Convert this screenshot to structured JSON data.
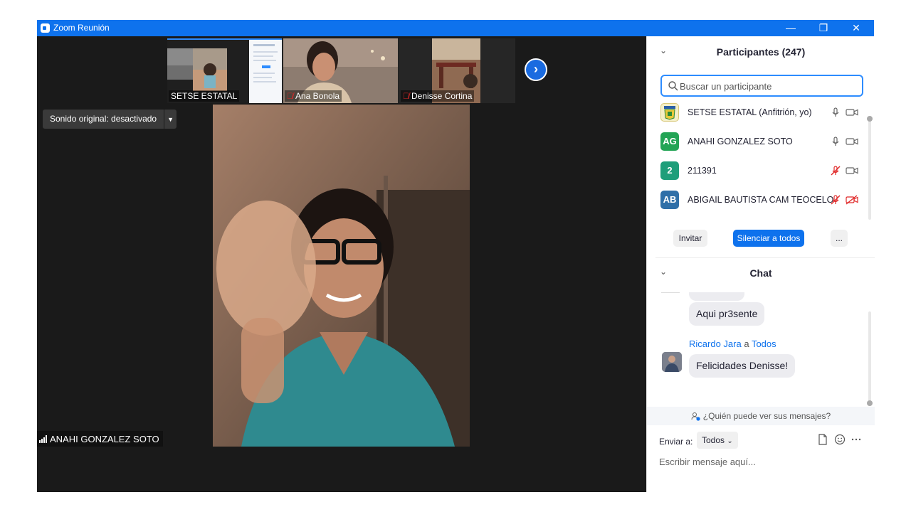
{
  "window": {
    "title": "Zoom Reunión",
    "controls": {
      "minimize": "—",
      "restore": "❐",
      "close": "✕"
    },
    "accent": "#0e72ed"
  },
  "video": {
    "thumbnails": [
      {
        "name": "SETSE ESTATAL",
        "muted": false
      },
      {
        "name": "Ana Bonola",
        "muted": true
      },
      {
        "name": "Denisse Cortina",
        "muted": true
      }
    ],
    "next_icon": "chevron-right-icon",
    "original_sound_label": "Sonido original: desactivado",
    "active_speaker": "ANAHI GONZALEZ SOTO"
  },
  "participants": {
    "title": "Participantes (247)",
    "search_placeholder": "Buscar un participante",
    "list": [
      {
        "name": "SETSE ESTATAL (Anfitrión, yo)",
        "initials": "",
        "avatar_color": "#e8d24a",
        "mic_muted": false,
        "video_off": false
      },
      {
        "name": "ANAHI GONZALEZ SOTO",
        "initials": "AG",
        "avatar_color": "#23a455",
        "mic_muted": false,
        "video_off": false
      },
      {
        "name": "211391",
        "initials": "2",
        "avatar_color": "#1e9e7a",
        "mic_muted": true,
        "video_off": false
      },
      {
        "name": "ABIGAIL BAUTISTA CAM TEOCELO",
        "initials": "AB",
        "avatar_color": "#2f6fa8",
        "mic_muted": true,
        "video_off": true
      }
    ],
    "buttons": {
      "invite": "Invitar",
      "mute_all": "Silenciar a todos",
      "more": "..."
    }
  },
  "chat": {
    "title": "Chat",
    "messages": [
      {
        "text": "Aqui pr3sente"
      },
      {
        "sender": "Ricardo Jara",
        "to_word": "a",
        "recipient": "Todos",
        "text": "Felicidades Denisse!"
      }
    ],
    "who_can_see": "¿Quién puede ver sus mensajes?",
    "send_to_label": "Enviar a:",
    "send_to_value": "Todos",
    "input_placeholder": "Escribir mensaje aquí..."
  }
}
